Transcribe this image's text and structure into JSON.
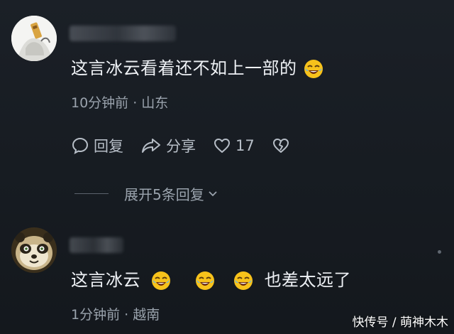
{
  "comment1": {
    "text": "这言冰云看着还不如上一部的",
    "emoji": "rolling-laughing-emoji",
    "meta": "10分钟前 · 山东",
    "actions": {
      "reply": "回复",
      "share": "分享",
      "likes": "17"
    },
    "expand": "展开5条回复"
  },
  "comment2": {
    "text_a": "这言冰云",
    "text_b": "也差太远了",
    "meta": "1分钟前 · 越南"
  },
  "watermark": "快传号 / 萌神木木"
}
